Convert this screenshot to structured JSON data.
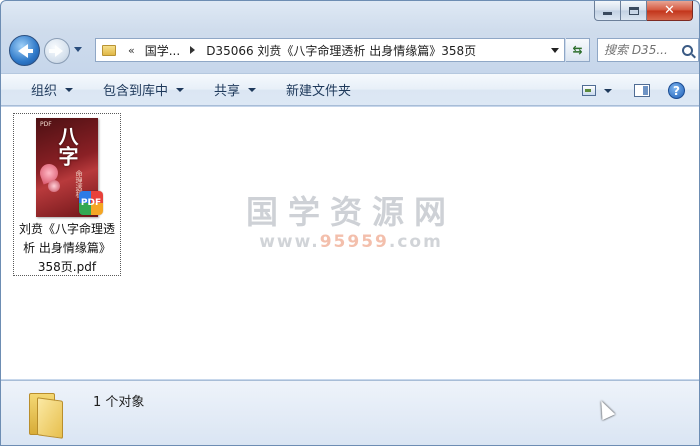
{
  "window": {
    "caption_buttons": {
      "close_glyph": "✕"
    }
  },
  "navigation": {
    "breadcrumb_overflow": "«",
    "breadcrumbs": [
      "国学...",
      "D35066 刘贲《八字命理透析 出身情缘篇》358页"
    ],
    "search_placeholder": "搜索 D35..."
  },
  "toolbar": {
    "organize": "组织",
    "include_in_library": "包含到库中",
    "share": "共享",
    "new_folder": "新建文件夹",
    "help": "?"
  },
  "files": [
    {
      "name": "刘贲《八字命理透析 出身情缘篇》358页.pdf",
      "name_lines": [
        "刘贲《八字命理透",
        "析 出身情缘篇》",
        "358页.pdf"
      ],
      "thumbnail": {
        "top_text": "PDF",
        "title": "八字",
        "subtitle": "命理透析"
      },
      "badge": "PDF"
    }
  ],
  "watermark": {
    "main": "国学资源网",
    "url_prefix": "www.",
    "url_accent": "95959",
    "url_suffix": ".com"
  },
  "details": {
    "count_text": "1 个对象"
  },
  "colors": {
    "accent": "#1e395b",
    "close": "#c2331a",
    "selection_border": "#5a5a5a"
  }
}
